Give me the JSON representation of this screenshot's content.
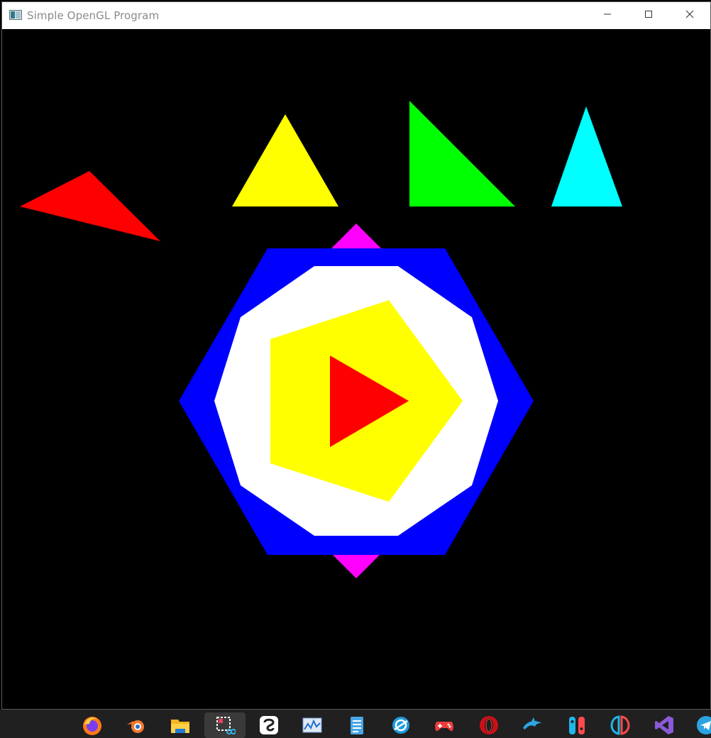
{
  "window": {
    "title": "Simple OpenGL Program",
    "icon": "opengl-window-icon",
    "controls": {
      "minimize": "minimize-icon",
      "maximize": "maximize-icon",
      "close": "close-icon"
    }
  },
  "scene": {
    "background": "#000000",
    "shapes": [
      {
        "name": "red-triangle-left",
        "color": "#ff0000"
      },
      {
        "name": "yellow-triangle",
        "color": "#ffff00"
      },
      {
        "name": "green-right-triangle",
        "color": "#00ff00"
      },
      {
        "name": "cyan-triangle",
        "color": "#00ffff"
      },
      {
        "name": "magenta-diamond",
        "color": "#ff00ff"
      },
      {
        "name": "blue-hexagon",
        "color": "#0000ff"
      },
      {
        "name": "white-octagon",
        "color": "#ffffff"
      },
      {
        "name": "yellow-pentagon",
        "color": "#ffff00"
      },
      {
        "name": "red-center-triangle",
        "color": "#ff0000"
      }
    ]
  },
  "taskbar": {
    "background": "#202020",
    "apps": [
      {
        "name": "firefox-icon"
      },
      {
        "name": "blender-icon"
      },
      {
        "name": "file-explorer-icon"
      },
      {
        "name": "snipping-tool-icon",
        "active": true
      },
      {
        "name": "clip-studio-icon"
      },
      {
        "name": "resource-monitor-icon"
      },
      {
        "name": "notepad-icon"
      },
      {
        "name": "browser-icon"
      },
      {
        "name": "game-controller-icon"
      },
      {
        "name": "opera-icon"
      },
      {
        "name": "dolphin-icon"
      },
      {
        "name": "switch-emulator-icon"
      },
      {
        "name": "yuzu-icon"
      },
      {
        "name": "visual-studio-icon"
      },
      {
        "name": "telegram-icon"
      }
    ]
  }
}
